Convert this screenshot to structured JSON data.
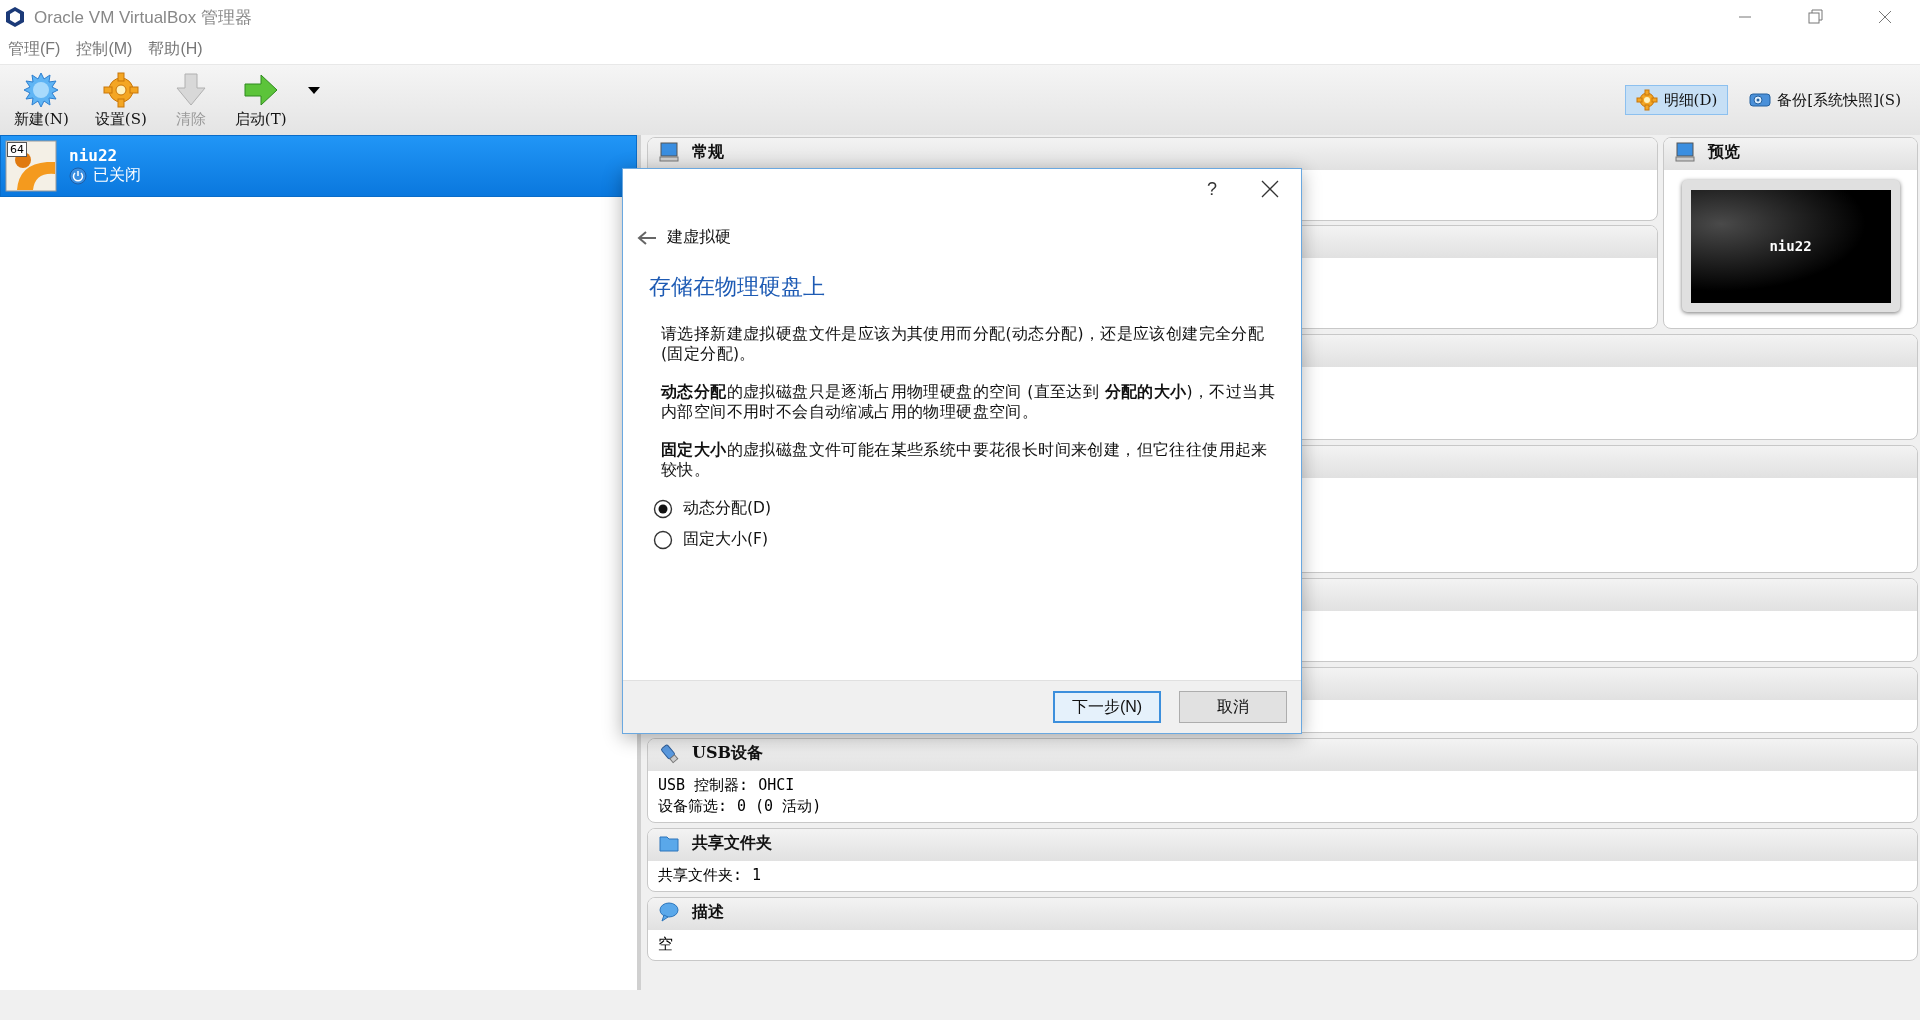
{
  "window": {
    "title": "Oracle VM VirtualBox 管理器"
  },
  "menu": [
    {
      "label": "管理(F)"
    },
    {
      "label": "控制(M)"
    },
    {
      "label": "帮助(H)"
    }
  ],
  "toolbar": {
    "items": [
      {
        "label": "新建(N)",
        "kind": "new",
        "disabled": false
      },
      {
        "label": "设置(S)",
        "kind": "settings",
        "disabled": false
      },
      {
        "label": "清除",
        "kind": "discard",
        "disabled": true
      },
      {
        "label": "启动(T)",
        "kind": "start",
        "disabled": false
      }
    ],
    "tools": [
      {
        "label": "明细(D)",
        "kind": "details",
        "selected": true
      },
      {
        "label": "备份[系统快照](S)",
        "kind": "snapshots",
        "selected": false
      }
    ]
  },
  "vm_list": [
    {
      "name": "niu22",
      "state": "已关闭",
      "badge": "64",
      "selected": true
    }
  ],
  "details": {
    "top_panels": [
      {
        "kind": "general",
        "title": "常规"
      },
      {
        "kind": "hidden"
      }
    ],
    "preview": {
      "title": "预览",
      "screen_text": "niu22"
    },
    "panels": [
      {
        "kind": "hidden"
      },
      {
        "kind": "hidden"
      },
      {
        "kind": "hidden"
      },
      {
        "kind": "hidden"
      },
      {
        "kind": "usb",
        "title": "USB设备",
        "lines": [
          {
            "label": "USB 控制器:",
            "value": "OHCI"
          },
          {
            "label": "设备筛选:",
            "value": "0 (0 活动)"
          }
        ]
      },
      {
        "kind": "shared",
        "title": "共享文件夹",
        "lines": [
          {
            "label": "共享文件夹:",
            "value": "1"
          }
        ]
      },
      {
        "kind": "description",
        "title": "描述",
        "lines": [
          {
            "label": "空"
          }
        ]
      }
    ]
  },
  "dialog": {
    "help": "?",
    "back_title": "建虚拟硬",
    "heading": "存储在物理硬盘上",
    "paragraphs": [
      "请选择新建虚拟硬盘文件是应该为其使用而分配(动态分配)，还是应该创建完全分配(固定分配)。",
      "**动态分配**的虚拟磁盘只是逐渐占用物理硬盘的空间 (直至达到 **分配的大小**)，不过当其内部空间不用时不会自动缩减占用的物理硬盘空间。",
      "**固定大小**的虚拟磁盘文件可能在某些系统中要花很长时间来创建，但它往往使用起来较快。"
    ],
    "options": [
      {
        "label": "动态分配(D)",
        "selected": true
      },
      {
        "label": "固定大小(F)",
        "selected": false
      }
    ],
    "buttons": [
      {
        "label": "下一步(N)",
        "default": true
      },
      {
        "label": "取消",
        "default": false
      }
    ]
  }
}
